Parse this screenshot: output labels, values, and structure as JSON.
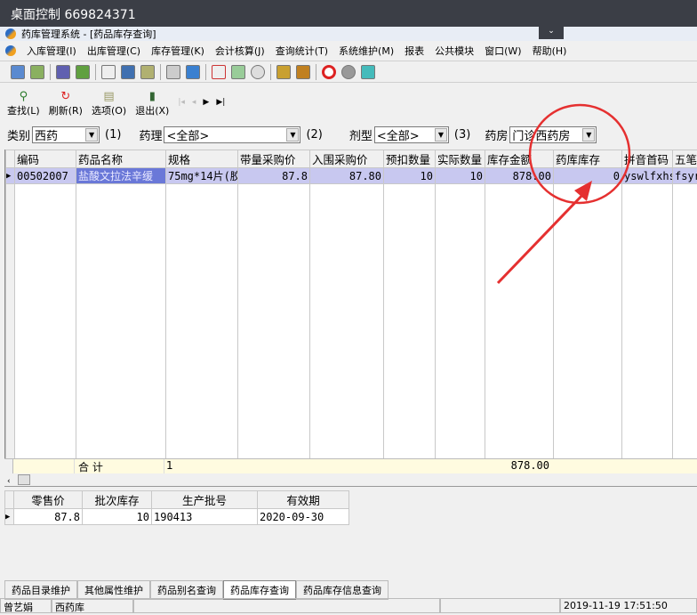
{
  "remote_title": "桌面控制 669824371",
  "app_title": "药库管理系统 - [药品库存查询]",
  "menu": [
    "入库管理(I)",
    "出库管理(C)",
    "库存管理(K)",
    "会计核算(J)",
    "查询统计(T)",
    "系统维护(M)",
    "报表",
    "公共模块",
    "窗口(W)",
    "帮助(H)"
  ],
  "actions": [
    {
      "label": "查找(L)",
      "icon": "search-icon"
    },
    {
      "label": "刷新(R)",
      "icon": "refresh-icon"
    },
    {
      "label": "选项(O)",
      "icon": "options-icon"
    },
    {
      "label": "退出(X)",
      "icon": "exit-icon"
    }
  ],
  "filters": {
    "category_label": "类别",
    "category": "西药",
    "n1": "(1)",
    "pharm_label": "药理",
    "pharm": "<全部>",
    "n2": "(2)",
    "form_label": "剂型",
    "form": "<全部>",
    "n3": "(3)",
    "pharmacy_label": "药房",
    "pharmacy": "门诊西药房"
  },
  "grid": {
    "columns": [
      "编码",
      "药品名称",
      "规格",
      "带量采购价",
      "入围采购价",
      "预扣数量",
      "实际数量",
      "库存金额",
      "药库库存",
      "拼音首码",
      "五笔"
    ],
    "rows": [
      [
        "00502007",
        "盐酸文拉法辛缓",
        "75mg*14片(胶",
        "87.8",
        "87.80",
        "10",
        "10",
        "878.00",
        "0",
        "yswlfxhs",
        "fsyr"
      ]
    ],
    "total_label": "合  计",
    "total_count": "1",
    "total_amount": "878.00"
  },
  "detail": {
    "columns": [
      "零售价",
      "批次库存",
      "生产批号",
      "有效期"
    ],
    "rows": [
      [
        "87.8",
        "10",
        "190413",
        "2020-09-30"
      ]
    ]
  },
  "tabs": [
    "药品目录维护",
    "其他属性维护",
    "药品别名查询",
    "药品库存查询",
    "药品库存信息查询"
  ],
  "active_tab": "药品库存查询",
  "status": {
    "user": "曾艺娟",
    "store": "西药库",
    "datetime": "2019-11-19 17:51:50"
  },
  "annotation_color": "#e53030"
}
